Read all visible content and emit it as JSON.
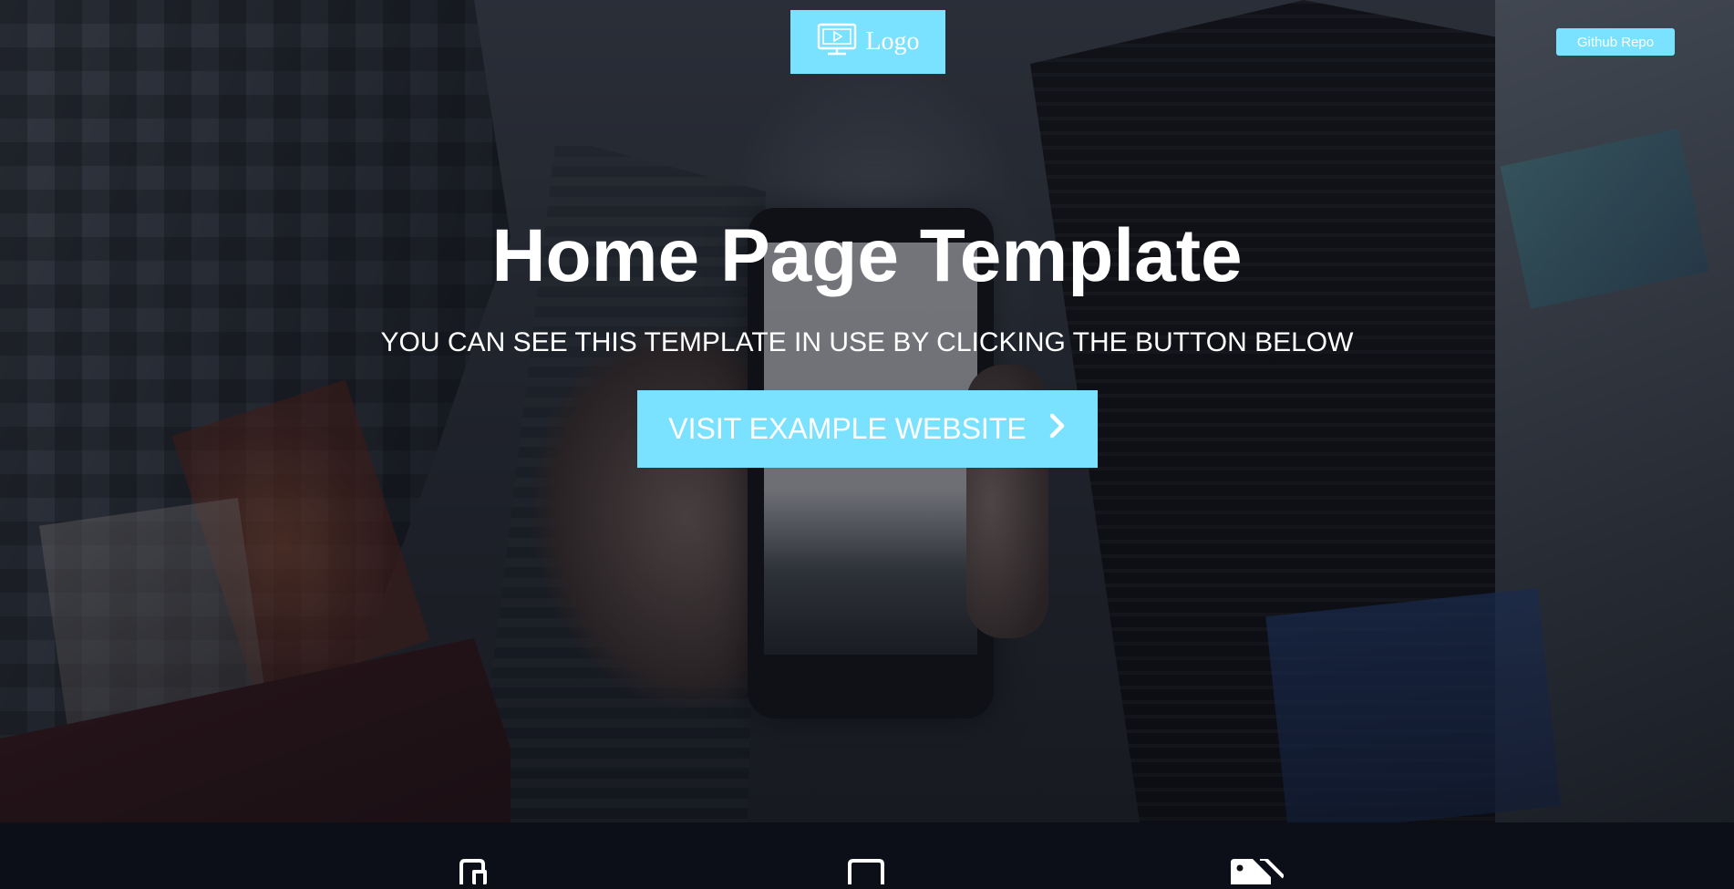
{
  "header": {
    "logo_label": "Logo",
    "logo_icon": "monitor-play-icon",
    "github_button": "Github Repo"
  },
  "hero": {
    "title": "Home Page Template",
    "subtitle": "YOU CAN SEE THIS TEMPLATE IN USE BY CLICKING THE BUTTON BELOW",
    "cta_label": "VISIT EXAMPLE WEBSITE",
    "cta_icon": "chevron-right-icon"
  },
  "features": {
    "icons": [
      "mobile-devices-icon",
      "tablet-icon",
      "tags-icon"
    ]
  },
  "colors": {
    "accent": "#7ae2ff",
    "footer_bg": "#0c0f17",
    "text": "#ffffff"
  }
}
